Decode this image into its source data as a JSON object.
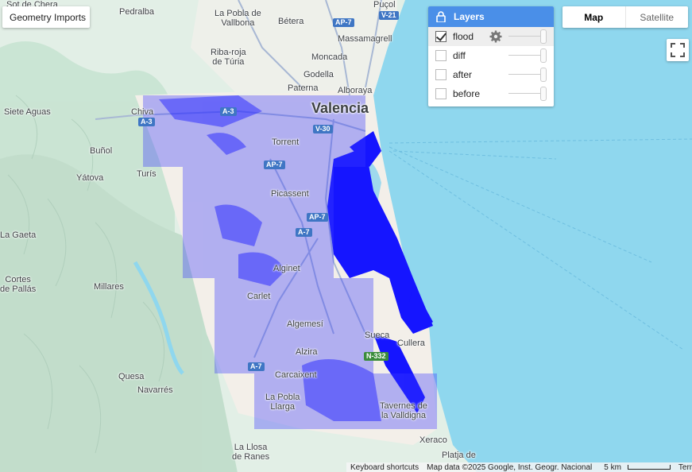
{
  "controls": {
    "geometry_imports": "Geometry Imports",
    "map_type": {
      "map": "Map",
      "satellite": "Satellite"
    },
    "layers_title": "Layers",
    "layers": [
      {
        "name": "flood",
        "checked": true
      },
      {
        "name": "diff",
        "checked": false
      },
      {
        "name": "after",
        "checked": false
      },
      {
        "name": "before",
        "checked": false
      }
    ]
  },
  "places": {
    "valencia": "Valencia",
    "pedralba": "Pedralba",
    "la_pobla_vallbona": "La Pobla de\nVallbona",
    "betera": "Bétera",
    "pucol": "Puçol",
    "massamagrell": "Massamagrell",
    "ribaroja": "Riba-roja\nde Túria",
    "moncada": "Moncada",
    "godella": "Godella",
    "paterna": "Paterna",
    "alboraya": "Alboraya",
    "siete_aguas": "Siete Aguas",
    "chiva": "Chiva",
    "bunol": "Buñol",
    "yatova": "Yátova",
    "turis": "Turís",
    "torrent": "Torrent",
    "picassent": "Picassent",
    "la_gaeta": "La Gaeta",
    "cortes_pallas": "Cortes\nde Pallás",
    "millares": "Millares",
    "alginet": "Alginet",
    "carlet": "Carlet",
    "algemesi": "Algemesí",
    "sueca": "Sueca",
    "cullera": "Cullera",
    "alzira": "Alzira",
    "carcaixent": "Carcaixent",
    "quesa": "Quesa",
    "navarres": "Navarrés",
    "la_pobla_llarga": "La Pobla\nLlarga",
    "tavernes": "Tavernes de\nla Valldigna",
    "la_llosa": "La Llosa\nde Ranes",
    "xeraco": "Xeraco",
    "platja": "Platja de",
    "sot_chera": "Sot de Chera"
  },
  "roads": {
    "v21": "V-21",
    "ap7a": "AP-7",
    "a3a": "A-3",
    "a3b": "A-3",
    "v30": "V-30",
    "ap7b": "AP-7",
    "ap7c": "AP-7",
    "a7a": "A-7",
    "a7b": "A-7",
    "n332": "N-332"
  },
  "footer": {
    "shortcuts": "Keyboard shortcuts",
    "attribution": "Map data ©2025 Google, Inst. Geogr. Nacional",
    "scale": "5 km",
    "terms": "Terms"
  },
  "colors": {
    "sea": "#8fd7ee",
    "land": "#f3efe9",
    "hills": "#cfe9d9",
    "flood": "#1515ff",
    "road": "#9fb1cf",
    "accent": "#4a8fe8"
  }
}
